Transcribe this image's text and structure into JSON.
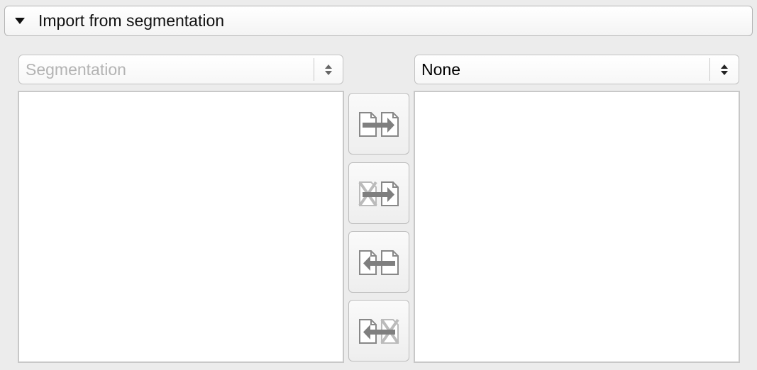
{
  "section": {
    "title": "Import from segmentation",
    "expand_icon": "triangle-down-icon"
  },
  "source_combo": {
    "value": "Segmentation",
    "enabled": false,
    "icon": "up-down-arrows-icon"
  },
  "target_combo": {
    "value": "None",
    "enabled": true,
    "icon": "up-down-arrows-icon"
  },
  "buttons": [
    {
      "name": "copy-selected-to-right-button",
      "icon": "doc-arrow-right-doc-icon",
      "enabled": true
    },
    {
      "name": "copy-all-to-right-button",
      "icon": "doc-x-arrow-right-doc-icon",
      "enabled": true
    },
    {
      "name": "copy-selected-to-left-button",
      "icon": "doc-arrow-left-doc-icon",
      "enabled": true
    },
    {
      "name": "copy-all-to-left-button",
      "icon": "doc-arrow-left-doc-x-icon",
      "enabled": true
    }
  ],
  "colors": {
    "background": "#ececec",
    "panel_border": "#c8c8c8",
    "arrow": "#7f7f7f",
    "disabled_text": "#b3b3b3"
  }
}
